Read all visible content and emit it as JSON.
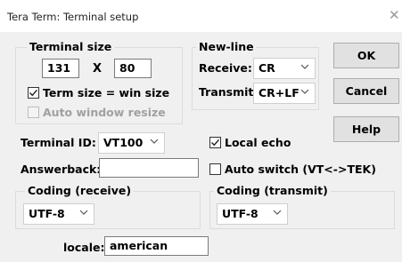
{
  "window": {
    "title": "Tera Term: Terminal setup"
  },
  "terminal_size": {
    "legend": "Terminal size",
    "cols": "131",
    "times": "X",
    "rows": "80",
    "term_eq_win_label": "Term size = win size",
    "term_eq_win_checked": true,
    "auto_resize_label": "Auto window resize",
    "auto_resize_checked": false,
    "auto_resize_enabled": false
  },
  "new_line": {
    "legend": "New-line",
    "receive_label": "Receive:",
    "receive_value": "CR",
    "transmit_label": "Transmit:",
    "transmit_value": "CR+LF"
  },
  "buttons": {
    "ok": "OK",
    "cancel": "Cancel",
    "help": "Help"
  },
  "terminal_id": {
    "label": "Terminal ID:",
    "value": "VT100"
  },
  "local_echo": {
    "label": "Local echo",
    "checked": true
  },
  "answerback": {
    "label": "Answerback:",
    "value": ""
  },
  "auto_switch": {
    "label": "Auto switch (VT<->TEK)",
    "checked": false
  },
  "coding_receive": {
    "legend": "Coding (receive)",
    "value": "UTF-8"
  },
  "coding_transmit": {
    "legend": "Coding (transmit)",
    "value": "UTF-8"
  },
  "locale": {
    "label": "locale:",
    "value": "american"
  },
  "icons": {
    "close": "close-icon",
    "dropdown": "chevron-down-icon",
    "check": "checkmark-icon"
  }
}
